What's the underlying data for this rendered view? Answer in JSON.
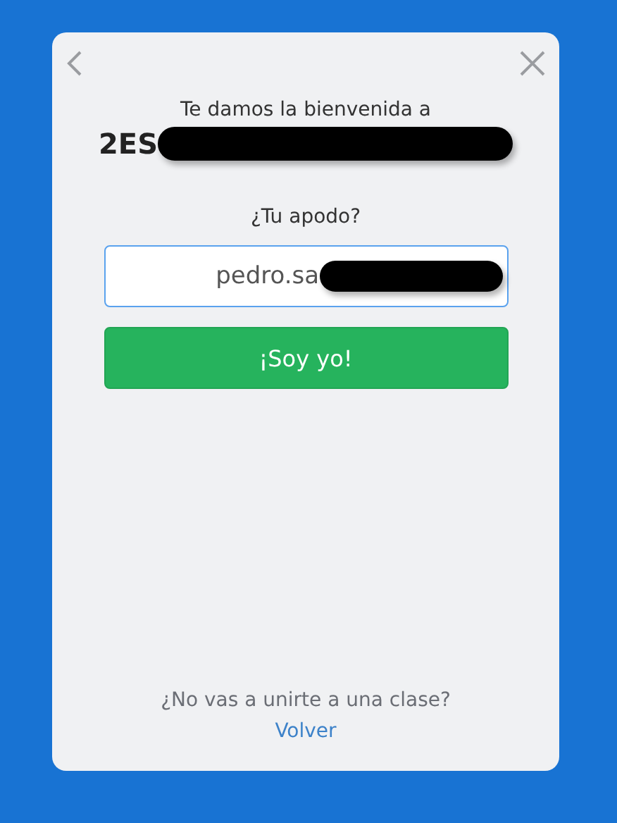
{
  "header": {
    "welcome": "Te damos la bienvenida a",
    "class_name": "2ES",
    "class_name_redacted": true
  },
  "nickname": {
    "label": "¿Tu apodo?",
    "value": "pedro.sa",
    "value_redacted": true
  },
  "submit_button": "¡Soy yo!",
  "footer": {
    "question": "¿No vas a unirte a una clase?",
    "link": "Volver"
  }
}
